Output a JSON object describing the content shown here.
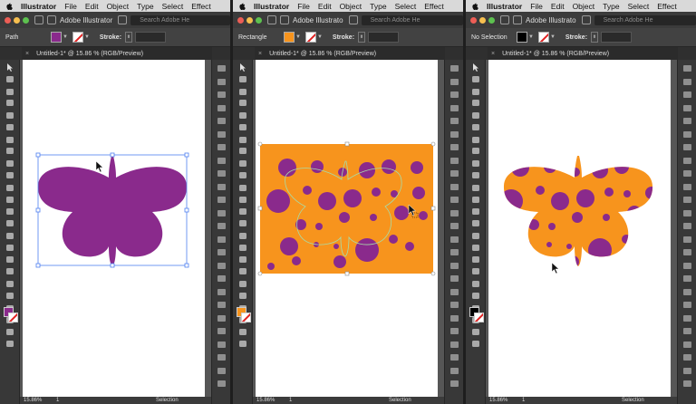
{
  "panels": [
    {
      "menubar": {
        "app": "Illustrator",
        "items": [
          "File",
          "Edit",
          "Object",
          "Type",
          "Select",
          "Effect"
        ]
      },
      "appbar": {
        "title": "Adobe Illustrator",
        "search_placeholder": "Search Adobe He"
      },
      "control": {
        "selection": "Path",
        "stroke_label": "Stroke:",
        "fill_color": "#8a2a8c"
      },
      "document_tab": {
        "close": "×",
        "title": "Untitled-1* @ 15.86 % (RGB/Preview)"
      },
      "status": {
        "zoom": "15.86%",
        "page": "1",
        "mode": "Selection"
      }
    },
    {
      "menubar": {
        "app": "Illustrator",
        "items": [
          "File",
          "Edit",
          "Object",
          "Type",
          "Select",
          "Effect"
        ]
      },
      "appbar": {
        "title": "Adobe Illustrato",
        "search_placeholder": "Search Adobe He"
      },
      "control": {
        "selection": "Rectangle",
        "stroke_label": "Stroke:",
        "fill_color": "#f7941d"
      },
      "document_tab": {
        "close": "×",
        "title": "Untitled-1* @ 15.86 % (RGB/Preview)"
      },
      "status": {
        "zoom": "15.86%",
        "page": "1",
        "mode": "Selection"
      }
    },
    {
      "menubar": {
        "app": "Illustrator",
        "items": [
          "File",
          "Edit",
          "Object",
          "Type",
          "Select",
          "Effect"
        ]
      },
      "appbar": {
        "title": "Adobe Illustrato",
        "search_placeholder": "Search Adobe He"
      },
      "control": {
        "selection": "No Selection",
        "stroke_label": "Stroke:",
        "fill_color": "#000000"
      },
      "document_tab": {
        "close": "×",
        "title": "Untitled-1* @ 15.86 % (RGB/Preview)"
      },
      "status": {
        "zoom": "15.86%",
        "page": "1",
        "mode": "Selection"
      }
    }
  ],
  "colors": {
    "purple": "#8a2a8c",
    "orange": "#f7941d",
    "selection_blue": "#4f7ff0"
  },
  "icons": [
    "apple-icon",
    "selection-tool-icon",
    "direct-selection-tool-icon",
    "pen-tool-icon",
    "type-tool-icon",
    "rectangle-tool-icon",
    "brush-tool-icon",
    "rotate-tool-icon",
    "eyedropper-tool-icon",
    "zoom-tool-icon",
    "hand-tool-icon",
    "cursor-arrow-icon",
    "shape-builder-cursor-icon"
  ]
}
